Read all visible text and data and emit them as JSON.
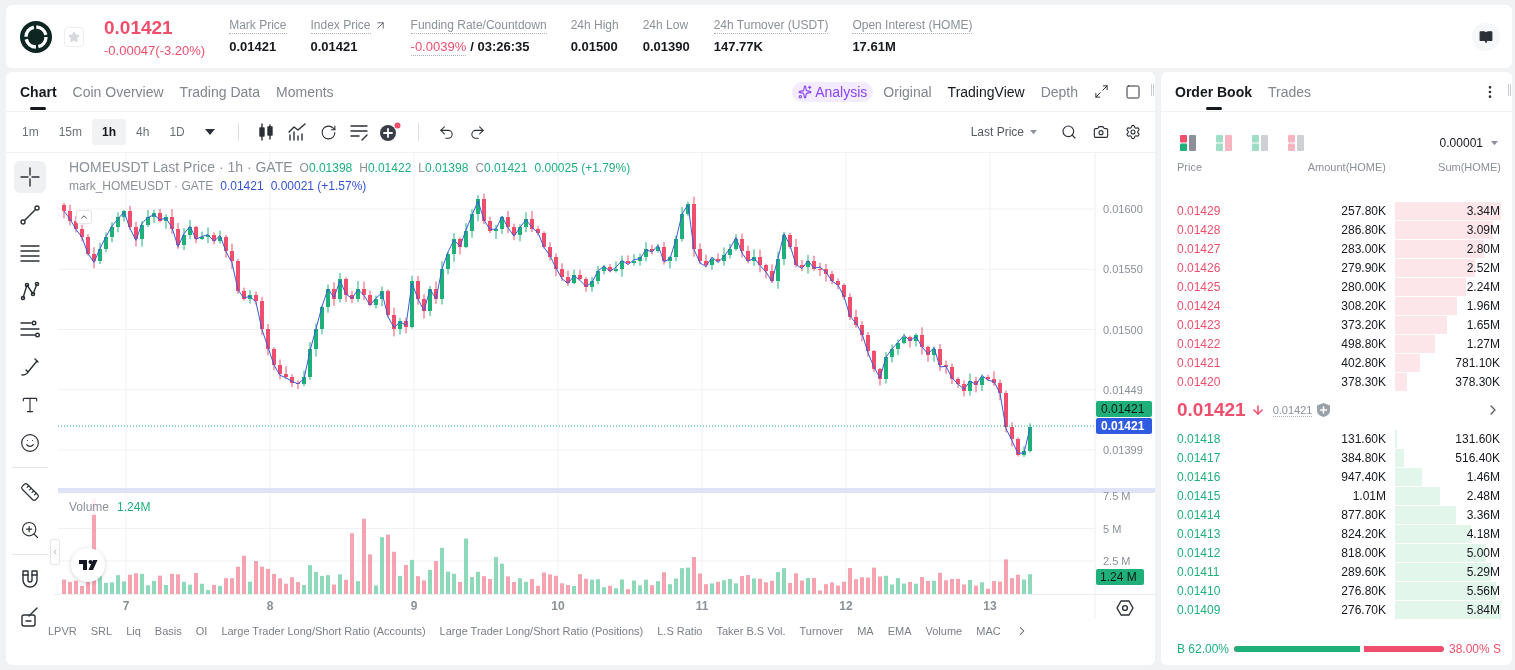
{
  "header": {
    "favorite": false,
    "last_price": "0.01421",
    "change": "-0.00047(-3.20%)",
    "falling": true,
    "stats": [
      {
        "label": "Mark Price",
        "value": "0.01421",
        "dotted": true,
        "external": false,
        "negative": false
      },
      {
        "label": "Index Price",
        "value": "0.01421",
        "dotted": true,
        "external": true,
        "negative": false
      },
      {
        "label": "Funding Rate/Countdown",
        "value": "-0.0039%",
        "countdown": "/ 03:26:35",
        "dotted": true,
        "external": false,
        "negative": true
      },
      {
        "label": "24h High",
        "value": "0.01500",
        "dotted": false,
        "external": false,
        "negative": false
      },
      {
        "label": "24h Low",
        "value": "0.01390",
        "dotted": false,
        "external": false,
        "negative": false
      },
      {
        "label": "24h Turnover (USDT)",
        "value": "147.77K",
        "dotted": true,
        "external": false,
        "negative": false
      },
      {
        "label": "Open Interest (HOME)",
        "value": "17.61M",
        "dotted": true,
        "external": false,
        "negative": false
      }
    ]
  },
  "chart_panel": {
    "tabs": [
      {
        "label": "Chart",
        "selected": true
      },
      {
        "label": "Coin Overview",
        "selected": false
      },
      {
        "label": "Trading Data",
        "selected": false
      },
      {
        "label": "Moments",
        "selected": false
      }
    ],
    "analysis_label": "Analysis",
    "views": [
      {
        "label": "Original",
        "selected": false
      },
      {
        "label": "TradingView",
        "selected": true
      },
      {
        "label": "Depth",
        "selected": false
      }
    ],
    "intervals": [
      {
        "label": "1m",
        "selected": false
      },
      {
        "label": "15m",
        "selected": false
      },
      {
        "label": "1h",
        "selected": true
      },
      {
        "label": "4h",
        "selected": false
      },
      {
        "label": "1D",
        "selected": false
      }
    ],
    "price_source": "Last Price",
    "tool_groups": [
      {
        "tools": [
          {
            "kind": "crosshair",
            "selected": true
          },
          {
            "kind": "line",
            "selected": false
          },
          {
            "kind": "hlines",
            "selected": false
          },
          {
            "kind": "path",
            "selected": false
          },
          {
            "kind": "channel",
            "selected": false
          },
          {
            "kind": "brush",
            "selected": false
          },
          {
            "kind": "text",
            "selected": false
          },
          {
            "kind": "emoji",
            "selected": false
          }
        ]
      },
      {
        "tools": [
          {
            "kind": "ruler",
            "selected": false
          },
          {
            "kind": "zoom",
            "selected": false
          }
        ]
      },
      {
        "tools": [
          {
            "kind": "magnet",
            "selected": false
          },
          {
            "kind": "eraser",
            "selected": false
          }
        ]
      }
    ],
    "legend": {
      "title": "HOMEUSDT Last Price · 1h · GATE",
      "ohlc": [
        {
          "key": "O",
          "value": "0.01398"
        },
        {
          "key": "H",
          "value": "0.01422"
        },
        {
          "key": "L",
          "value": "0.01398"
        },
        {
          "key": "C",
          "value": "0.01421"
        }
      ],
      "change": "0.00025 (+1.79%)",
      "rising": true,
      "mark_title": "mark_HOMEUSDT · GATE",
      "mark_values": [
        "0.01421",
        "0.00021 (+1.57%)"
      ]
    },
    "price_axis": [
      "0.01600",
      "0.01550",
      "0.01500",
      "0.01449",
      "0.01399"
    ],
    "last_price_tag": "0.01421",
    "mark_price_tag": "0.01421",
    "volume": {
      "label": "Volume",
      "value": "1.24M",
      "axis": [
        "7.5 M",
        "5 M",
        "2.5 M"
      ],
      "tag": "1.24 M"
    },
    "time_axis": [
      "7",
      "8",
      "9",
      "10",
      "11",
      "12",
      "13"
    ],
    "indicators": [
      "LPVR",
      "SRL",
      "Liq",
      "Basis",
      "OI",
      "Large Trader Long/Short Ratio (Accounts)",
      "Large Trader Long/Short Ratio (Positions)",
      "L.S Ratio",
      "Taker B.S Vol.",
      "Turnover",
      "MA",
      "EMA",
      "Volume",
      "MAC"
    ]
  },
  "order_book": {
    "tabs": [
      {
        "label": "Order Book",
        "selected": true
      },
      {
        "label": "Trades",
        "selected": false
      }
    ],
    "layouts": [
      {
        "kind": "default",
        "selected": true
      },
      {
        "kind": "both",
        "selected": false
      },
      {
        "kind": "bids",
        "selected": false
      },
      {
        "kind": "asks",
        "selected": false
      }
    ],
    "precision": "0.00001",
    "columns": [
      "Price",
      "Amount(HOME)",
      "Sum(HOME)"
    ],
    "asks": [
      {
        "price": "0.01429",
        "amount": "257.80K",
        "sum": "3.34M"
      },
      {
        "price": "0.01428",
        "amount": "286.80K",
        "sum": "3.09M"
      },
      {
        "price": "0.01427",
        "amount": "283.00K",
        "sum": "2.80M"
      },
      {
        "price": "0.01426",
        "amount": "279.90K",
        "sum": "2.52M"
      },
      {
        "price": "0.01425",
        "amount": "280.00K",
        "sum": "2.24M"
      },
      {
        "price": "0.01424",
        "amount": "308.20K",
        "sum": "1.96M"
      },
      {
        "price": "0.01423",
        "amount": "373.20K",
        "sum": "1.65M"
      },
      {
        "price": "0.01422",
        "amount": "498.80K",
        "sum": "1.27M"
      },
      {
        "price": "0.01421",
        "amount": "402.80K",
        "sum": "781.10K"
      },
      {
        "price": "0.01420",
        "amount": "378.30K",
        "sum": "378.30K"
      }
    ],
    "last_price": "0.01421",
    "falling": true,
    "mark_price": "0.01421",
    "bids": [
      {
        "price": "0.01418",
        "amount": "131.60K",
        "sum": "131.60K"
      },
      {
        "price": "0.01417",
        "amount": "384.80K",
        "sum": "516.40K"
      },
      {
        "price": "0.01416",
        "amount": "947.40K",
        "sum": "1.46M"
      },
      {
        "price": "0.01415",
        "amount": "1.01M",
        "sum": "2.48M"
      },
      {
        "price": "0.01414",
        "amount": "877.80K",
        "sum": "3.36M"
      },
      {
        "price": "0.01413",
        "amount": "824.20K",
        "sum": "4.18M"
      },
      {
        "price": "0.01412",
        "amount": "818.00K",
        "sum": "5.00M"
      },
      {
        "price": "0.01411",
        "amount": "289.60K",
        "sum": "5.29M"
      },
      {
        "price": "0.01410",
        "amount": "276.80K",
        "sum": "5.56M"
      },
      {
        "price": "0.01409",
        "amount": "276.70K",
        "sum": "5.84M"
      }
    ],
    "ratio": {
      "buy_label": "B 62.00%",
      "sell_label": "38.00% S",
      "level": 0.62
    }
  }
}
